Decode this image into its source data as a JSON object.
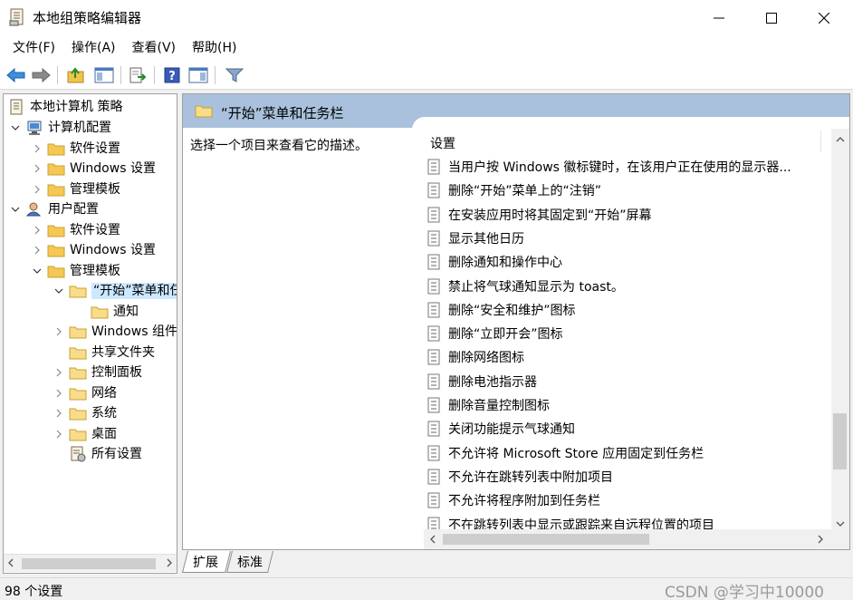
{
  "window": {
    "title": "本地组策略编辑器"
  },
  "menu": [
    {
      "label": "文件(F)"
    },
    {
      "label": "操作(A)"
    },
    {
      "label": "查看(V)"
    },
    {
      "label": "帮助(H)"
    }
  ],
  "toolbar": {
    "buttons": [
      "back-icon",
      "forward-icon",
      "up-folder-icon",
      "show-hide-tree-icon",
      "export-list-icon",
      "help-icon",
      "properties-pane-icon",
      "filter-icon"
    ]
  },
  "tree": {
    "root": "本地计算机 策略",
    "computer_config": "计算机配置",
    "cc_software": "软件设置",
    "cc_windows": "Windows 设置",
    "cc_admin": "管理模板",
    "user_config": "用户配置",
    "uc_software": "软件设置",
    "uc_windows": "Windows 设置",
    "uc_admin": "管理模板",
    "start_menu": "“开始”菜单和任",
    "notify": "通知",
    "win_components": "Windows 组件",
    "shared_folders": "共享文件夹",
    "control_panel": "控制面板",
    "network": "网络",
    "system": "系统",
    "desktop": "桌面",
    "all_settings": "所有设置"
  },
  "right": {
    "header_title": "“开始”菜单和任务栏",
    "description": "选择一个项目来查看它的描述。",
    "column_header": "设置",
    "settings": [
      "当用户按 Windows 徽标键时，在该用户正在使用的显示器...",
      "删除“开始”菜单上的“注销”",
      "在安装应用时将其固定到“开始”屏幕",
      "显示其他日历",
      "删除通知和操作中心",
      "禁止将气球通知显示为 toast。",
      "删除“安全和维护”图标",
      "删除“立即开会”图标",
      "删除网络图标",
      "删除电池指示器",
      "删除音量控制图标",
      "关闭功能提示气球通知",
      "不允许将 Microsoft Store 应用固定到任务栏",
      "不允许在跳转列表中附加项目",
      "不允许将程序附加到任务栏",
      "不在跳转列表中显示或跟踪来自远程位置的项目"
    ]
  },
  "tabs": {
    "extended": "扩展",
    "standard": "标准"
  },
  "status": {
    "count_text": "98 个设置",
    "watermark": "CSDN @学习中10000"
  },
  "colors": {
    "header_bg": "#a9c1dc",
    "selection": "#cce8ff",
    "folder_yellow": "#f5c853"
  }
}
